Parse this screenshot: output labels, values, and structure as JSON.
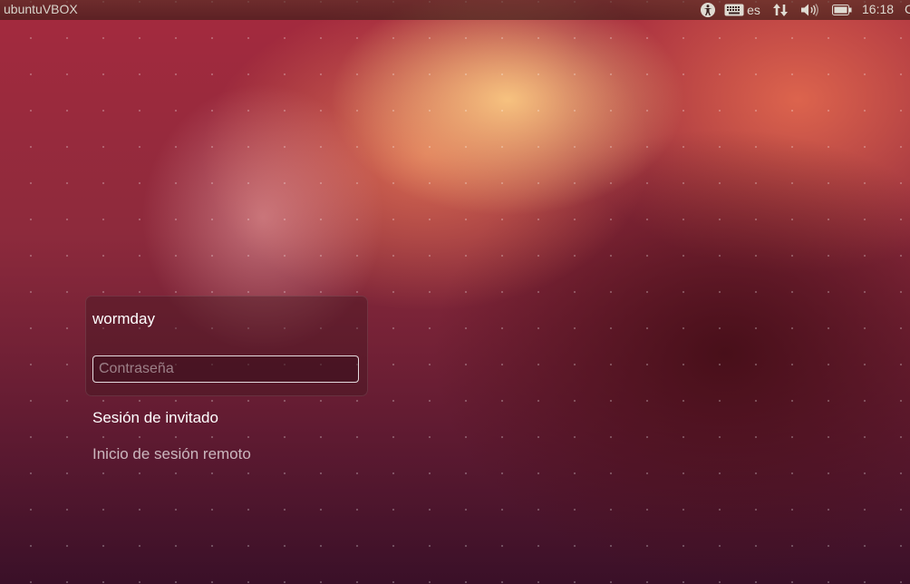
{
  "top_panel": {
    "host_name": "ubuntuVBOX",
    "keyboard_layout": "es",
    "clock": "16:18",
    "power_partial": "C",
    "icons": [
      "accessibility-icon",
      "keyboard-icon",
      "network-icon",
      "volume-icon",
      "battery-icon"
    ]
  },
  "greeter": {
    "user_name": "wormday",
    "password_placeholder": "Contraseña",
    "guest_session": "Sesión de invitado",
    "remote_login": "Inicio de sesión remoto"
  },
  "colors": {
    "panel_text": "#dfdbd2",
    "greeter_text": "#ffffff"
  }
}
